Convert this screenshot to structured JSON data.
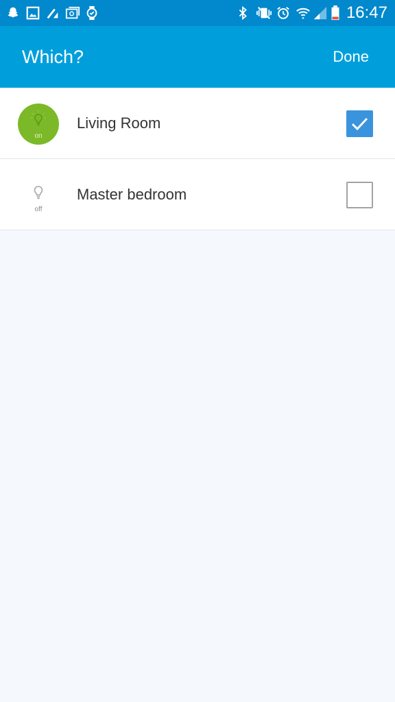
{
  "status_bar": {
    "time": "16:47",
    "left_icons": [
      "snapchat-icon",
      "image-icon",
      "signal-alt-icon",
      "email-icon",
      "watch-icon"
    ],
    "right_icons": [
      "bluetooth-icon",
      "vibrate-icon",
      "alarm-icon",
      "wifi-icon",
      "cell-signal-icon",
      "battery-icon"
    ],
    "color": "#0288cc"
  },
  "app_bar": {
    "title": "Which?",
    "done_label": "Done",
    "color": "#009fdc"
  },
  "devices": [
    {
      "name": "Living Room",
      "state": "on",
      "checked": true,
      "icon": "lightbulb-icon",
      "accent": "#7cb928"
    },
    {
      "name": "Master bedroom",
      "state": "off",
      "checked": false,
      "icon": "lightbulb-icon"
    }
  ],
  "colors": {
    "checkbox_checked": "#3a93dd",
    "background": "#f5f8fc"
  }
}
